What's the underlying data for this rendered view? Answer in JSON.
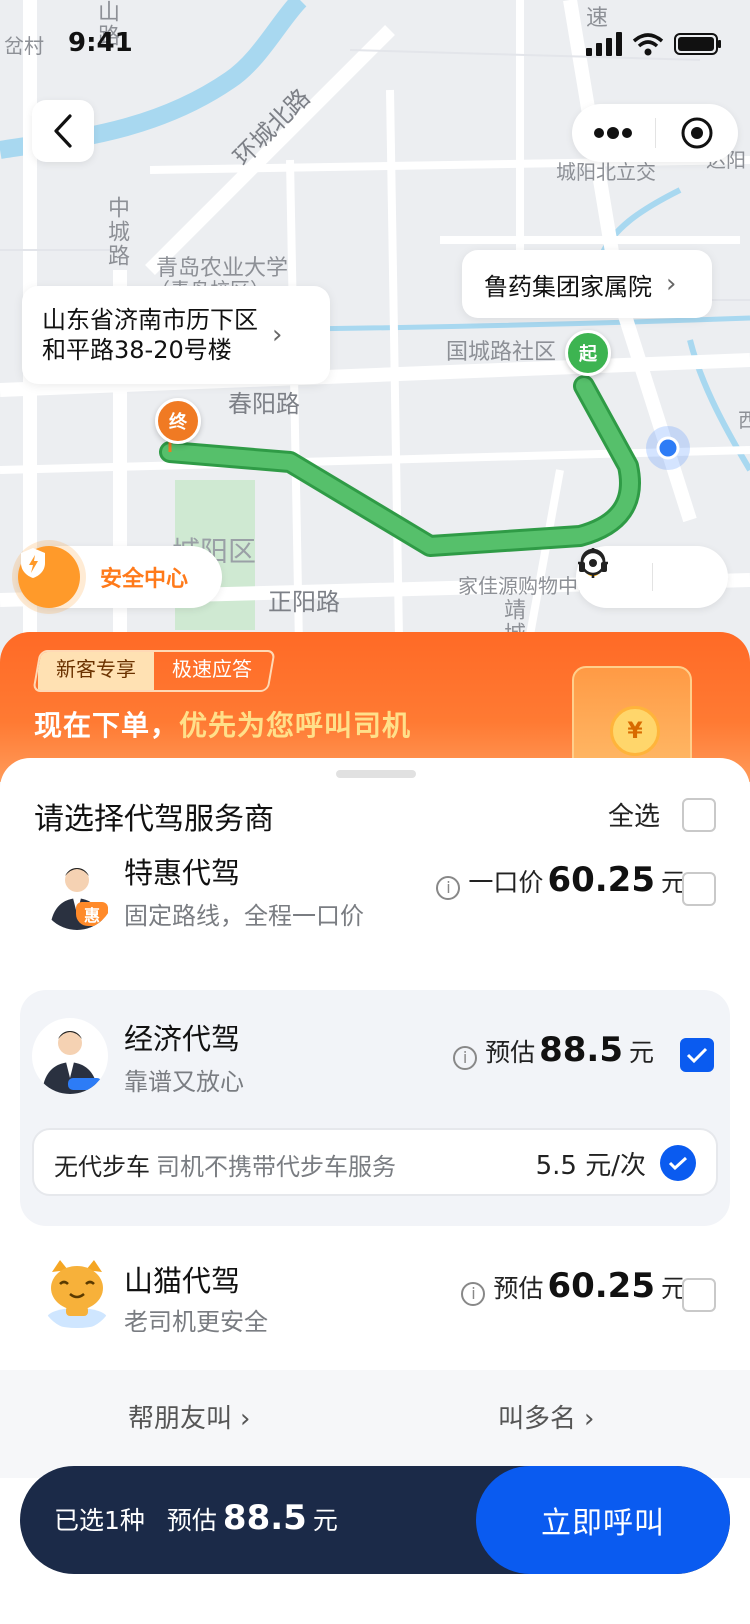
{
  "status": {
    "time": "9:41"
  },
  "map": {
    "labels": {
      "huancheng": "环城北路",
      "zhongcheng": "中城路",
      "shan": "山路",
      "qingdao": "青岛农业大学",
      "qingdao_sub": "（青岛校区）",
      "chunyang": "春阳路",
      "guocheng": "国城路社区",
      "chengyang_n": "城阳北立交",
      "chengyang_q": "城阳区",
      "zhengyang": "正阳路",
      "jiajia": "家佳源购物中心",
      "jing": "靖城",
      "cun": "岔村",
      "su": "速",
      "dayang": "达阳",
      "xi": "西"
    },
    "end_address_line1": "山东省济南市历下区",
    "end_address_line2": "和平路38-20号楼",
    "start_address": "鲁药集团家属院",
    "pin_start": "起",
    "pin_end": "终",
    "safety_label": "安全中心"
  },
  "promo": {
    "tag_new": "新客专享",
    "tag_fast": "极速应答",
    "title_a": "现在下单，",
    "title_b": "优先为您呼叫司机",
    "coin": "¥"
  },
  "sheet": {
    "title": "请选择代驾服务商",
    "select_all": "全选",
    "providers": [
      {
        "name": "特惠代驾",
        "desc": "固定路线，全程一口价",
        "price_prefix": "一口价",
        "price": "60.25",
        "unit": "元",
        "badge": "惠",
        "selected": false
      },
      {
        "name": "经济代驾",
        "desc": "靠谱又放心",
        "price_prefix": "预估",
        "price": "88.5",
        "unit": "元",
        "selected": true
      },
      {
        "name": "山猫代驾",
        "desc": "老司机更安全",
        "price_prefix": "预估",
        "price": "60.25",
        "unit": "元",
        "selected": false
      }
    ],
    "addon": {
      "label": "无代步车",
      "desc": "司机不携带代步车服务",
      "price": "5.5 元/次",
      "selected": true
    },
    "link_friend": "帮朋友叫",
    "link_multi": "叫多名"
  },
  "bottom": {
    "selected_count": "已选1种",
    "estimate_label": "预估",
    "estimate_price": "88.5",
    "unit": "元",
    "call_button": "立即呼叫"
  },
  "colors": {
    "accent": "#0a5bf0",
    "route": "#4cb563",
    "promo": "#ff6a26",
    "bar": "#1b2a48"
  }
}
